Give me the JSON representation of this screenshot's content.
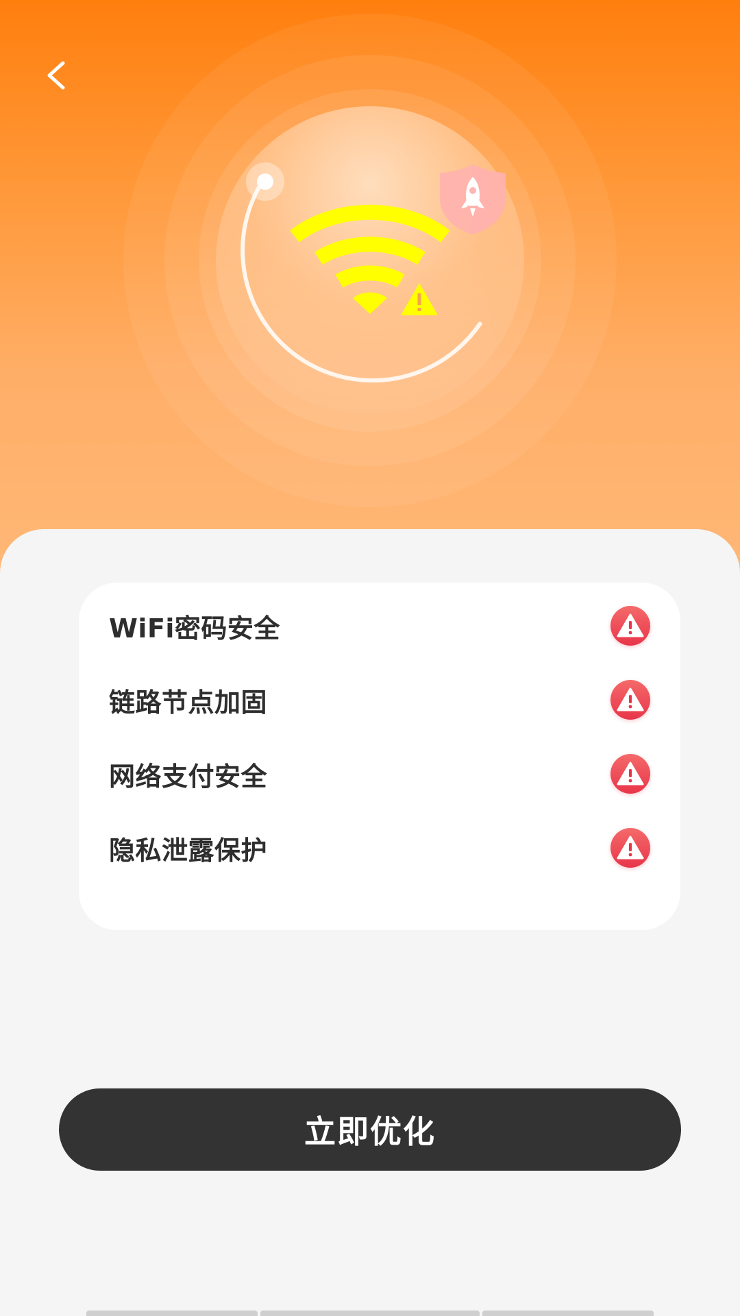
{
  "header": {
    "back_icon": "chevron-left-icon",
    "hero_icon": "wifi-icon",
    "hero_warning_icon": "warning-triangle-icon",
    "badge_icon": "rocket-shield-icon",
    "accent_color": "#ff7f0e",
    "wifi_color": "#ffff00"
  },
  "checklist": {
    "items": [
      {
        "label": "WiFi密码安全",
        "status_icon": "warning-icon"
      },
      {
        "label": "链路节点加固",
        "status_icon": "warning-icon"
      },
      {
        "label": "网络支付安全",
        "status_icon": "warning-icon"
      },
      {
        "label": "隐私泄露保护",
        "status_icon": "warning-icon"
      }
    ],
    "warning_color": "#e8354a"
  },
  "action": {
    "label": "立即优化"
  }
}
